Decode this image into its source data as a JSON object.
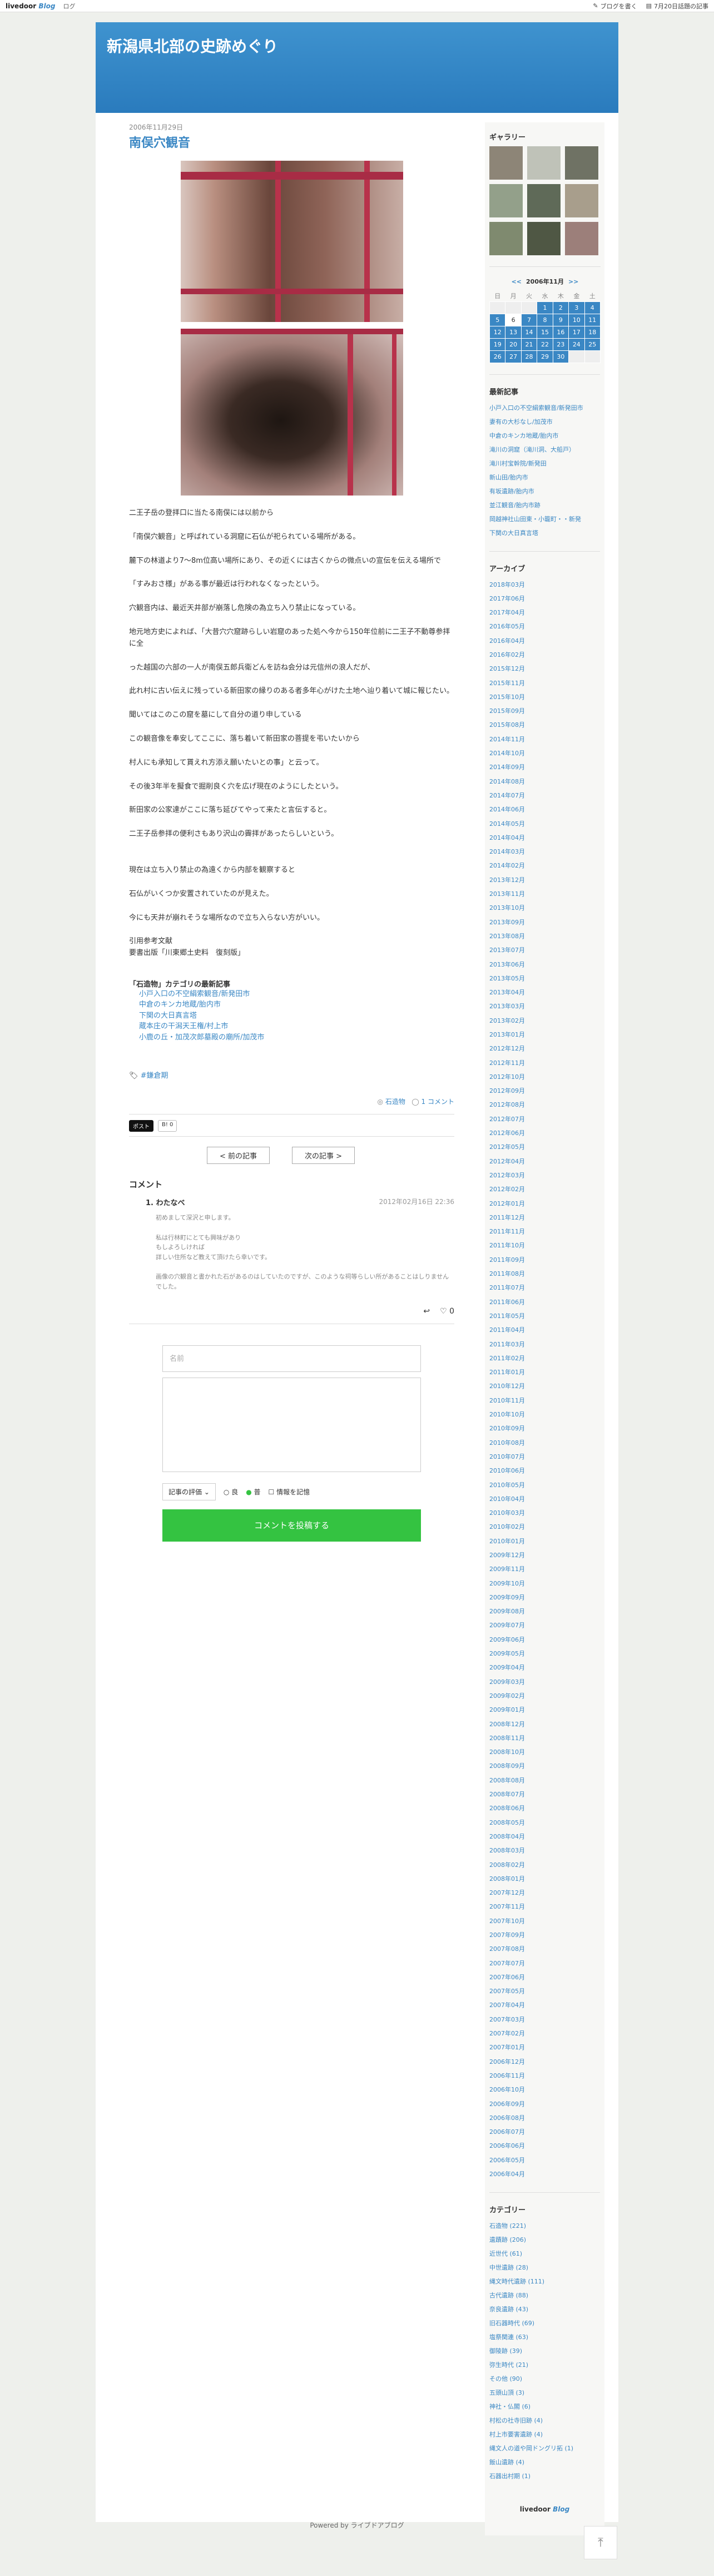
{
  "topbar": {
    "logo": "livedoor",
    "logo_blog": "Blog",
    "nav": "ログ",
    "write": "ブログを書く",
    "popular": "7月20日話題の記事"
  },
  "blog_title": "新潟県北部の史跡めぐり",
  "post": {
    "date": "2006年11月29日",
    "title": "南俣穴観音",
    "paragraphs": [
      "二王子岳の登拝口に当たる南俣には以前から",
      "「南俣穴観音」と呼ばれている洞窟に石仏が祀られている場所がある。",
      "麓下の林道より7〜8m位高い場所にあり、その近くには古くからの微点いの宣伝を伝える場所で",
      "「すみおさ様」がある事が最近は行われなくなったという。",
      "穴観音内は、最近天井部が崩落し危険の為立ち入り禁止になっている。",
      "地元地方史によれば、「大昔穴穴窟跡らしい岩窟のあった処へ今から150年位前に二王子不動尊参拝に全",
      "った越国の六部の一人が南俣五郎兵衛どんを訪ね会分は元信州の浪人だが、",
      "此れ村に古い伝えに残っている新田家の縁りのある者多年心がけた土地へ辿り着いて城に報じたい。",
      "聞いてはこのこの窟を墓にして自分の道り申している",
      "この観音像を奉安してここに、落ち着いて新田家の菩提を弔いたいから",
      "村人にも承知して貰えれ方添え願いたいとの事」と云って。",
      "その後3年半を擬食で掘削良く穴を広げ現在のようにしたという。",
      "新田家の公家達がここに落ち延びてやって来たと言伝すると。",
      "二王子岳参拝の便利さもあり沢山の霽拝があったらしいという。",
      "現在は立ち入り禁止の為遠くから内部を観察すると",
      "石仏がいくつか安置されていたのが見えた。",
      "今にも天井が崩れそうな場所なので立ち入らない方がいい。",
      "引用参考文献\n要書出版「川東郷土史料　復刻版」"
    ],
    "related_title": "「石造物」カテゴリの最新記事",
    "related": [
      "小戸入口の不空絹索観音/新発田市",
      "中倉のキンカ地蔵/胎内市",
      "下関の大日真言塔",
      "蔵本庄の干潟天王権/村上市",
      "小鹿の丘・加茂次郎墓殿の廟所/加茂市"
    ],
    "tag": "#鎌倉期",
    "category": "石造物",
    "comment_count": "1 コメント",
    "share_x": "ポスト",
    "share_hatena": "B! 0",
    "prev": "< 前の記事",
    "next": "次の記事 >"
  },
  "comments": {
    "heading": "コメント",
    "items": [
      {
        "author": "1. わたなべ",
        "time": "2012年02月16日 22:36",
        "text": "初めまして深沢と申します。\n\n私は行林町にとても興味があり\nもしよろしければ\n詳しい住所など教えて頂けたら幸いです。\n\n画像の穴観音と書かれた石があるのはしていたのですが、このような祠等らしい所があることはしりませんでした。"
      }
    ],
    "likes": "0"
  },
  "form": {
    "name_placeholder": "名前",
    "rating": "記事の評価",
    "opt1": "良",
    "opt2": "普",
    "opt3": "情報を記憶",
    "submit": "コメントを投稿する"
  },
  "sidebar": {
    "gallery_title": "ギャラリー",
    "calendar": {
      "prev": "<<",
      "title": "2006年11月",
      "next": ">>",
      "weekdays": [
        "日",
        "月",
        "火",
        "水",
        "木",
        "金",
        "土"
      ],
      "rows": [
        [
          "",
          "",
          "",
          "1",
          "2",
          "3",
          "4"
        ],
        [
          "5",
          "6",
          "7",
          "8",
          "9",
          "10",
          "11"
        ],
        [
          "12",
          "13",
          "14",
          "15",
          "16",
          "17",
          "18"
        ],
        [
          "19",
          "20",
          "21",
          "22",
          "23",
          "24",
          "25"
        ],
        [
          "26",
          "27",
          "28",
          "29",
          "30",
          "",
          ""
        ]
      ]
    },
    "recent_title": "最新記事",
    "recent": [
      "小戸入口の不空絹索観音/新発田市",
      "妻有の大杉なし/加茂市",
      "中倉のキンカ地蔵/胎内市",
      "滝川の洞窟（滝川洞、大船戸）",
      "滝川村宝幹院/新発田",
      "新山田/胎内市",
      "有坂遺跡/胎内市",
      "並江観音/胎内市跡",
      "岡越神社山田東・小籠町・・新発",
      "下関の大日真言塔"
    ],
    "archive_title": "アーカイブ",
    "archive": [
      "2018年03月",
      "2017年06月",
      "2017年04月",
      "2016年05月",
      "2016年04月",
      "2016年02月",
      "2015年12月",
      "2015年11月",
      "2015年10月",
      "2015年09月",
      "2015年08月",
      "2014年11月",
      "2014年10月",
      "2014年09月",
      "2014年08月",
      "2014年07月",
      "2014年06月",
      "2014年05月",
      "2014年04月",
      "2014年03月",
      "2014年02月",
      "2013年12月",
      "2013年11月",
      "2013年10月",
      "2013年09月",
      "2013年08月",
      "2013年07月",
      "2013年06月",
      "2013年05月",
      "2013年04月",
      "2013年03月",
      "2013年02月",
      "2013年01月",
      "2012年12月",
      "2012年11月",
      "2012年10月",
      "2012年09月",
      "2012年08月",
      "2012年07月",
      "2012年06月",
      "2012年05月",
      "2012年04月",
      "2012年03月",
      "2012年02月",
      "2012年01月",
      "2011年12月",
      "2011年11月",
      "2011年10月",
      "2011年09月",
      "2011年08月",
      "2011年07月",
      "2011年06月",
      "2011年05月",
      "2011年04月",
      "2011年03月",
      "2011年02月",
      "2011年01月",
      "2010年12月",
      "2010年11月",
      "2010年10月",
      "2010年09月",
      "2010年08月",
      "2010年07月",
      "2010年06月",
      "2010年05月",
      "2010年04月",
      "2010年03月",
      "2010年02月",
      "2010年01月",
      "2009年12月",
      "2009年11月",
      "2009年10月",
      "2009年09月",
      "2009年08月",
      "2009年07月",
      "2009年06月",
      "2009年05月",
      "2009年04月",
      "2009年03月",
      "2009年02月",
      "2009年01月",
      "2008年12月",
      "2008年11月",
      "2008年10月",
      "2008年09月",
      "2008年08月",
      "2008年07月",
      "2008年06月",
      "2008年05月",
      "2008年04月",
      "2008年03月",
      "2008年02月",
      "2008年01月",
      "2007年12月",
      "2007年11月",
      "2007年10月",
      "2007年09月",
      "2007年08月",
      "2007年07月",
      "2007年06月",
      "2007年05月",
      "2007年04月",
      "2007年03月",
      "2007年02月",
      "2007年01月",
      "2006年12月",
      "2006年11月",
      "2006年10月",
      "2006年09月",
      "2006年08月",
      "2006年07月",
      "2006年06月",
      "2006年05月",
      "2006年04月"
    ],
    "category_title": "カテゴリー",
    "categories": [
      "石造物 (221)",
      "遺蹟跡 (206)",
      "近世代 (61)",
      "中世遺跡 (28)",
      "縄文時代遺跡 (111)",
      "古代遺跡 (88)",
      "奈良遺跡 (43)",
      "旧石器時代 (69)",
      "塩祭関連 (63)",
      "御陵跡 (39)",
      "弥生時代 (21)",
      "その他 (90)",
      "五頭山頂 (3)",
      "神社・仏閣 (6)",
      "村松の社寺旧跡 (4)",
      "村上市要害遺跡 (4)",
      "縄文人の道や岡ドングリ拓 (1)",
      "飯山遺跡 (4)",
      "石器出村期 (1)"
    ],
    "logo": "livedoor",
    "logo_blog": "Blog"
  },
  "footer": "Powered by ライブドアブログ"
}
